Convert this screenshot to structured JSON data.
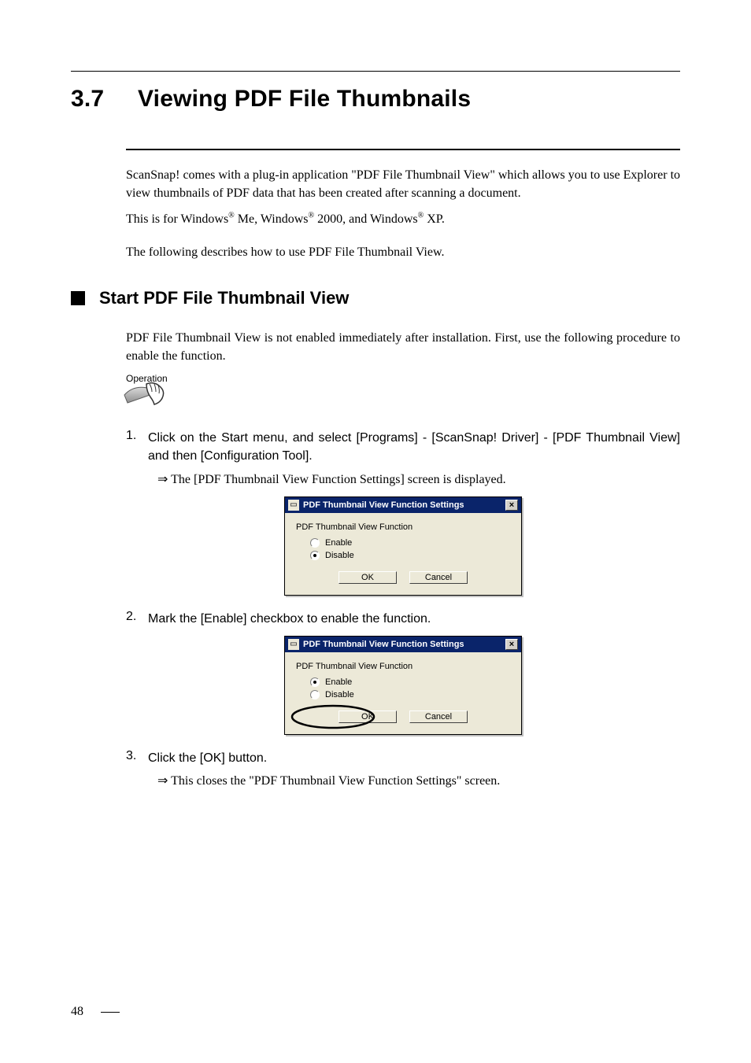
{
  "heading": {
    "number": "3.7",
    "title": "Viewing PDF File Thumbnails"
  },
  "intro": {
    "line1a": "ScanSnap! comes with a plug-in application \"PDF File Thumbnail View\" which allows you to use",
    "line1b": "Explorer to view thumbnails of PDF data that has been created after scanning a document.",
    "line2_prefix": "This is for Windows",
    "line2_r1": "®",
    "line2_mid1": " Me, Windows",
    "line2_r2": "®",
    "line2_mid2": " 2000, and Windows",
    "line2_r3": "®",
    "line2_suffix": " XP.",
    "line3": "The following describes how to use PDF File Thumbnail View."
  },
  "subhead": "Start PDF File Thumbnail View",
  "subhead_body": "PDF File Thumbnail View is not enabled immediately after installation. First, use the following procedure to enable the function.",
  "operation_label": "Operation",
  "steps": {
    "s1": {
      "num": "1.",
      "text": "Click on the Start menu, and select [Programs] - [ScanSnap! Driver] - [PDF Thumbnail View] and then [Configuration Tool].",
      "result": "The [PDF Thumbnail View Function Settings] screen is displayed."
    },
    "s2": {
      "num": "2.",
      "text": "Mark the [Enable] checkbox to enable the function."
    },
    "s3": {
      "num": "3.",
      "text": "Click the [OK] button.",
      "result": "This closes the \"PDF Thumbnail View Function Settings\" screen."
    }
  },
  "dialog": {
    "title": "PDF Thumbnail View Function Settings",
    "group": "PDF Thumbnail View Function",
    "enable": "Enable",
    "disable": "Disable",
    "ok": "OK",
    "cancel": "Cancel"
  },
  "page_number": "48",
  "arrow": "⇒"
}
